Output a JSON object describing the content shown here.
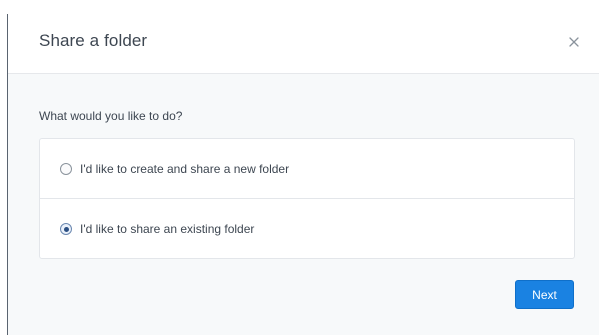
{
  "dialog": {
    "title": "Share a folder",
    "close_icon": "close-icon",
    "question": "What would you like to do?",
    "options": [
      {
        "label": "I'd like to create and share a new folder",
        "selected": false
      },
      {
        "label": "I'd like to share an existing folder",
        "selected": true
      }
    ],
    "next_label": "Next"
  },
  "colors": {
    "accent": "#1a82e2",
    "body_background": "#f7f9fa",
    "text": "#3d4651"
  }
}
